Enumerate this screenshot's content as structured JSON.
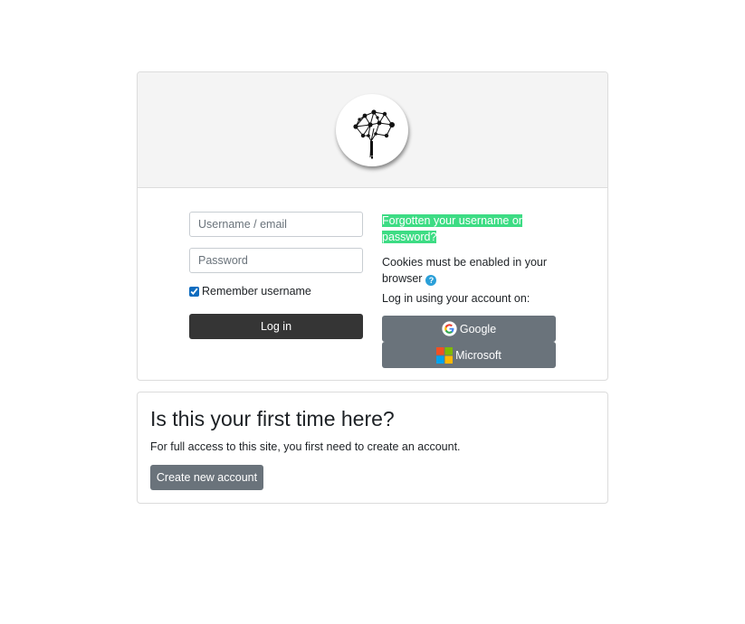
{
  "logo": {
    "icon": "tree-network-logo"
  },
  "login": {
    "username_placeholder": "Username / email",
    "password_placeholder": "Password",
    "remember_label": "Remember username",
    "remember_checked": true,
    "login_button": "Log in"
  },
  "help": {
    "forgot_link": "Forgotten your username or password?",
    "cookies_text": "Cookies must be enabled in your browser",
    "help_icon": "?",
    "login_using": "Log in using your account on:",
    "google_button": "Google",
    "microsoft_button": "Microsoft"
  },
  "signup": {
    "title": "Is this your first time here?",
    "text": "For full access to this site, you first need to create an account.",
    "button": "Create new account"
  },
  "colors": {
    "primary_dark": "#353535",
    "secondary": "#6a737b",
    "highlight": "#3ddc84",
    "help_blue": "#2a9fd8"
  }
}
